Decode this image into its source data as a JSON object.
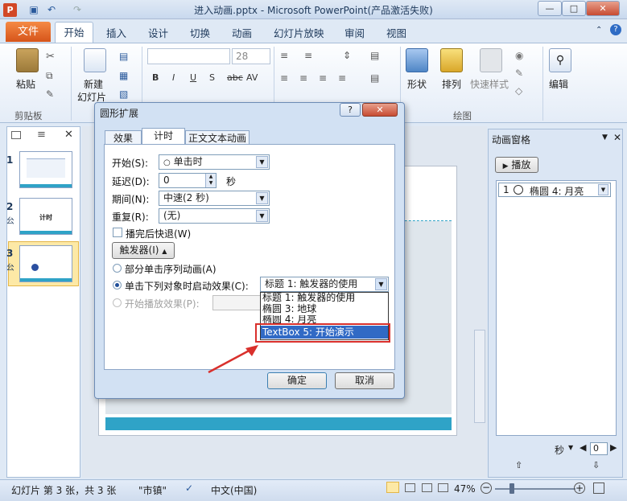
{
  "window": {
    "title": "进入动画.pptx - Microsoft PowerPoint(产品激活失败)",
    "app_icon_letter": "P"
  },
  "ribbon_tabs": [
    "文件",
    "开始",
    "插入",
    "设计",
    "切换",
    "动画",
    "幻灯片放映",
    "审阅",
    "视图"
  ],
  "ribbon": {
    "paste_label": "粘贴",
    "new_slide_label": "新建",
    "new_slide_label2": "幻灯片",
    "font_size": "28",
    "shape_label": "形状",
    "arrange_label": "排列",
    "quick_style_label": "快速样式",
    "edit_label": "编辑",
    "groups": {
      "clipboard": "剪贴板",
      "drawing": "绘图"
    },
    "font_buttons": [
      "B",
      "I",
      "U",
      "S",
      "abc",
      "AV"
    ]
  },
  "slides_pane": {
    "items": [
      {
        "num": "1",
        "sub": ""
      },
      {
        "num": "2",
        "sub": "㕕",
        "thumb_text": "计时"
      },
      {
        "num": "3",
        "sub": "㕕"
      }
    ]
  },
  "animation_pane": {
    "title": "动画窗格",
    "play_label": "播放",
    "item_index": "1",
    "item_label": "椭圆 4: 月亮",
    "seconds_label": "秒",
    "seconds_value": "0"
  },
  "dialog": {
    "title": "圆形扩展",
    "tabs": [
      "效果",
      "计时",
      "正文文本动画"
    ],
    "start_label": "开始(S):",
    "start_value": "单击时",
    "delay_label": "延迟(D):",
    "delay_value": "0",
    "delay_unit": "秒",
    "period_label": "期间(N):",
    "period_value": "中速(2 秒)",
    "repeat_label": "重复(R):",
    "repeat_value": "(无)",
    "rewind_label": "播完后快退(W)",
    "trigger_label": "触发器(I)",
    "radio1_label": "部分单击序列动画(A)",
    "radio2_label": "单击下列对象时启动效果(C):",
    "radio3_label": "开始播放效果(P):",
    "trigger_value": "标题 1: 触发器的使用",
    "trigger_options": [
      "标题 1: 触发器的使用",
      "椭圆 3: 地球",
      "椭圆 4: 月亮",
      "TextBox 5: 开始演示"
    ],
    "ok_label": "确定",
    "cancel_label": "取消"
  },
  "statusbar": {
    "slide_info": "幻灯片 第 3 张，共 3 张",
    "theme": "\"市镇\"",
    "language": "中文(中国)",
    "zoom": "47%"
  },
  "colors": {
    "file_tab": "#e3692b",
    "highlight_red": "#d9302c",
    "selected_blue": "#316ac5"
  }
}
